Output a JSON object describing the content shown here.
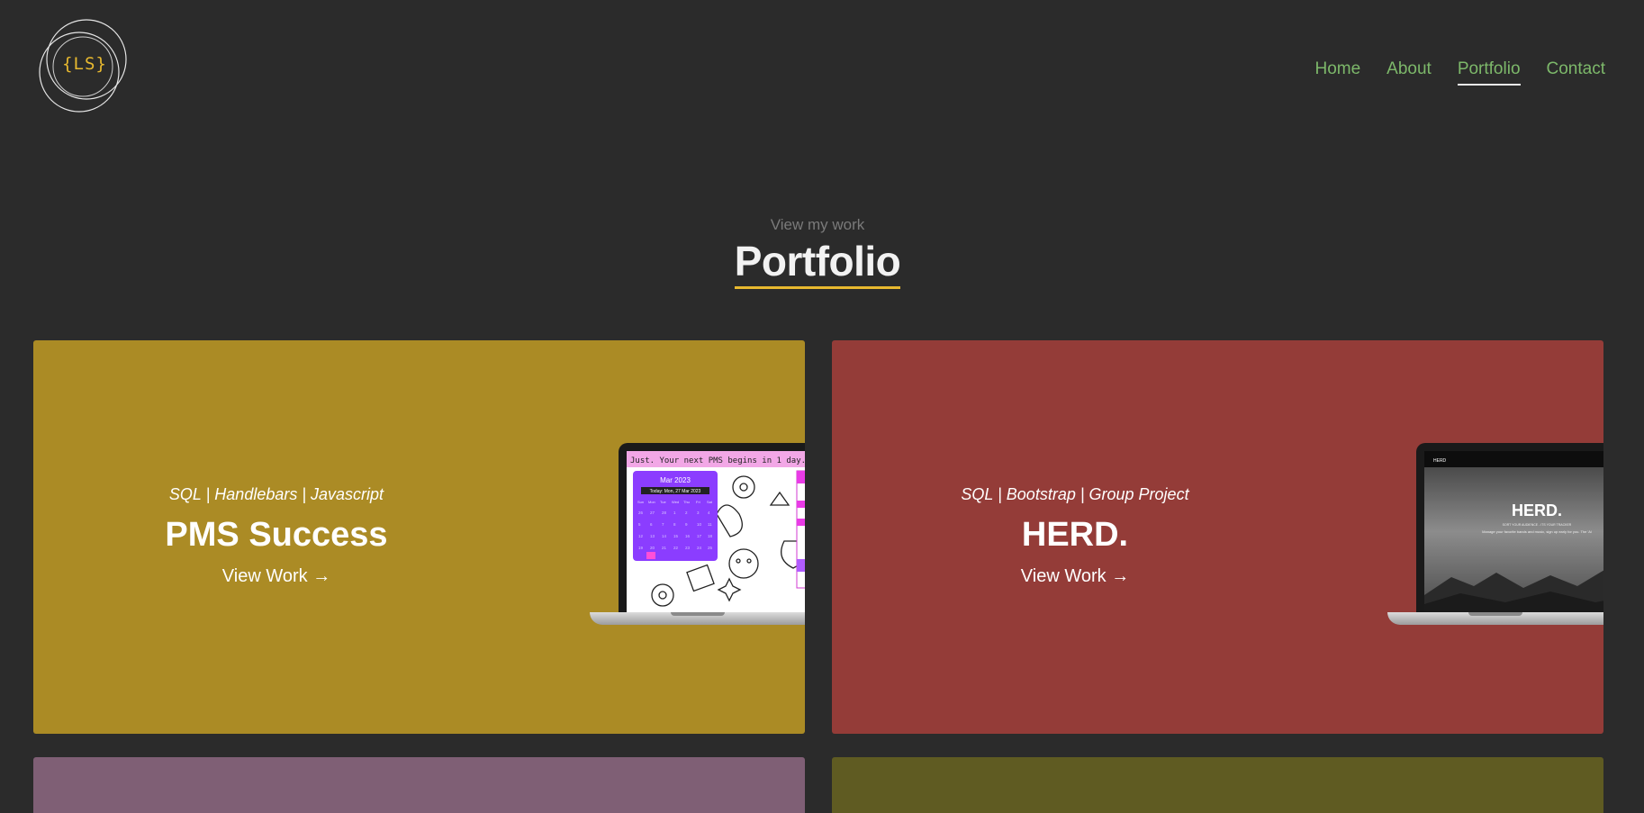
{
  "brand": {
    "logo_text": "{LS}",
    "logo_icon": "overlapping-circles-logo"
  },
  "nav": {
    "items": [
      {
        "label": "Home",
        "active": false
      },
      {
        "label": "About",
        "active": false
      },
      {
        "label": "Portfolio",
        "active": true
      },
      {
        "label": "Contact",
        "active": false
      }
    ]
  },
  "section": {
    "kicker": "View my work",
    "title": "Portfolio"
  },
  "projects": [
    {
      "tags": "SQL | Handlebars | Javascript",
      "title": "PMS Success",
      "link": "View Work →",
      "bg": "#ab8b25",
      "screen": {
        "banner": "Just. Your next PMS begins in 1 day.",
        "calendar_month": "Mar 2023",
        "calendar_today": "Today: Mon, 27 Mar 2023",
        "weekdays": [
          "Sun",
          "Mon",
          "Tue",
          "Wed",
          "Thu",
          "Fri",
          "Sat"
        ]
      }
    },
    {
      "tags": "SQL | Bootstrap | Group Project",
      "title": "HERD.",
      "link": "View Work →",
      "bg": "#943c38",
      "screen": {
        "nav_brand": "HERD",
        "hero_title": "HERD.",
        "hero_subtitle": "SORT YOUR AUDIENCE - ITS YOUR TRACKER",
        "hero_text": "Manage your favorite bands and music, sign up early for you. The 'Al"
      }
    },
    {
      "bg": "#7f5f75"
    },
    {
      "bg": "#5f5b22"
    }
  ],
  "colors": {
    "page_bg": "#2b2b2b",
    "nav_link": "#7db86a",
    "accent": "#e8b92f"
  }
}
